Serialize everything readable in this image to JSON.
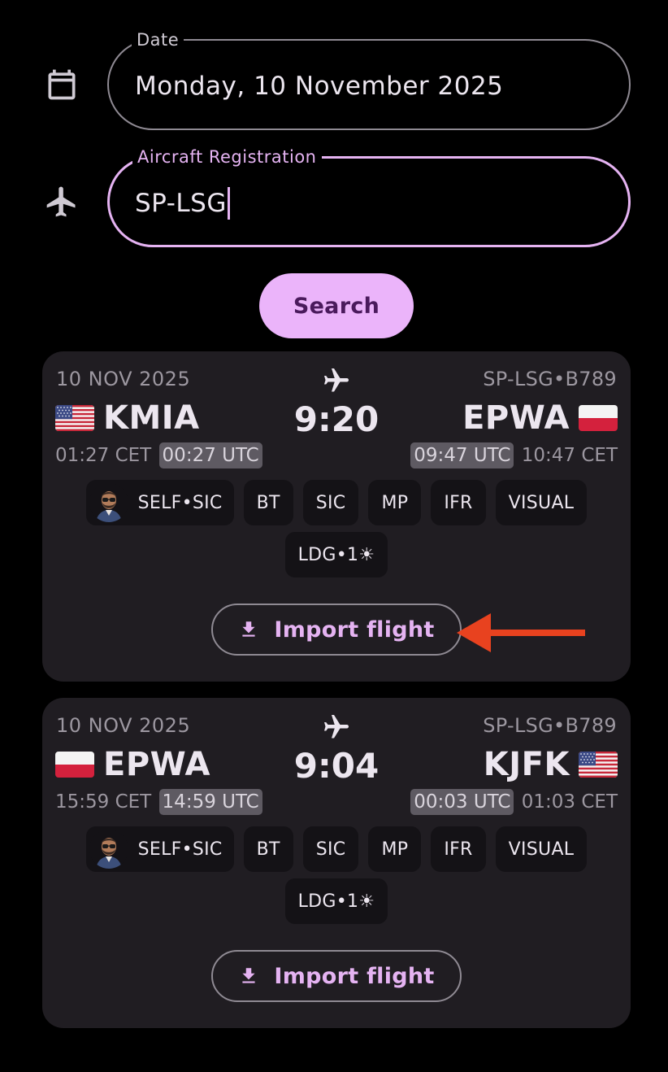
{
  "form": {
    "date_label": "Date",
    "date_value": "Monday, 10 November 2025",
    "date_icon": "calendar-icon",
    "reg_label": "Aircraft Registration",
    "reg_value": "SP-LSG",
    "reg_icon": "airplane-icon",
    "search_label": "Search"
  },
  "colors": {
    "accent": "#e5b3f2",
    "search_bg": "#ebb4fa",
    "card_bg": "#201d22",
    "annotation_arrow": "#e8421f"
  },
  "flights": [
    {
      "date": "10 NOV 2025",
      "registration": "SP-LSG•B789",
      "origin": {
        "code": "KMIA",
        "flag": "us",
        "local": "01:27 CET",
        "utc": "00:27 UTC"
      },
      "destination": {
        "code": "EPWA",
        "flag": "pl",
        "local": "10:47 CET",
        "utc": "09:47 UTC"
      },
      "duration": "9:20",
      "chips": [
        "SELF•SIC",
        "BT",
        "SIC",
        "MP",
        "IFR",
        "VISUAL"
      ],
      "landing_chip": "LDG•1☀",
      "import_label": "Import flight"
    },
    {
      "date": "10 NOV 2025",
      "registration": "SP-LSG•B789",
      "origin": {
        "code": "EPWA",
        "flag": "pl",
        "local": "15:59 CET",
        "utc": "14:59 UTC"
      },
      "destination": {
        "code": "KJFK",
        "flag": "us",
        "local": "01:03 CET",
        "utc": "00:03 UTC"
      },
      "duration": "9:04",
      "chips": [
        "SELF•SIC",
        "BT",
        "SIC",
        "MP",
        "IFR",
        "VISUAL"
      ],
      "landing_chip": "LDG•1☀",
      "import_label": "Import flight"
    }
  ]
}
